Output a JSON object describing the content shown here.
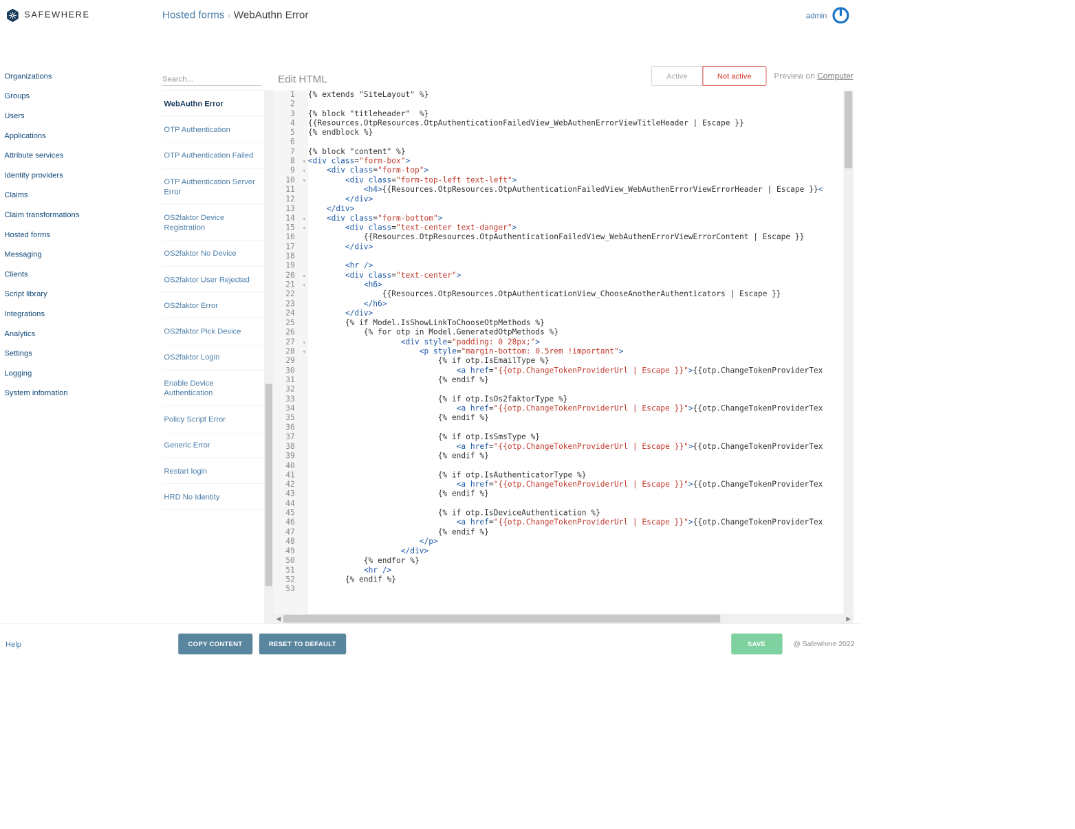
{
  "header": {
    "logo_text": "SAFEWHERE",
    "breadcrumb_parent": "Hosted forms",
    "breadcrumb_sep": "›",
    "breadcrumb_current": "WebAuthn Error",
    "admin": "admin"
  },
  "sidebar": {
    "items": [
      "Organizations",
      "Groups",
      "Users",
      "Applications",
      "Attribute services",
      "Identity providers",
      "Claims",
      "Claim transformations",
      "Hosted forms",
      "Messaging",
      "Clients",
      "Script library",
      "Integrations",
      "Analytics",
      "Settings",
      "Logging",
      "System infomation"
    ]
  },
  "content": {
    "search_placeholder": "Search...",
    "edit_title": "Edit HTML",
    "toggle_active": "Active",
    "toggle_not_active": "Not active",
    "preview_prefix": "Preview on ",
    "preview_link": "Computer"
  },
  "form_list": {
    "selected_index": 0,
    "items": [
      "WebAuthn Error",
      "OTP Authentication",
      "OTP Authentication Failed",
      "OTP Authentication Server Error",
      "OS2faktor Device Registration",
      "OS2faktor No Device",
      "OS2faktor User Rejected",
      "OS2faktor Error",
      "OS2faktor Pick Device",
      "OS2faktor Login",
      "Enable Device Authentication",
      "Policy Script Error",
      "Generic Error",
      "Restart login",
      "HRD No Identity"
    ]
  },
  "editor": {
    "lines": [
      {
        "n": 1,
        "f": "",
        "html": "{% extends \"SiteLayout\" %}"
      },
      {
        "n": 2,
        "f": "",
        "html": ""
      },
      {
        "n": 3,
        "f": "",
        "html": "{% block \"titleheader\"  %}"
      },
      {
        "n": 4,
        "f": "",
        "html": "{{Resources.OtpResources.OtpAuthenticationFailedView_WebAuthenErrorViewTitleHeader | Escape }}"
      },
      {
        "n": 5,
        "f": "",
        "html": "{% endblock %}"
      },
      {
        "n": 6,
        "f": "",
        "html": ""
      },
      {
        "n": 7,
        "f": "",
        "html": "{% block \"content\" %}"
      },
      {
        "n": 8,
        "f": "▾",
        "html": "<span class='t-pun'>&lt;</span><span class='t-tag'>div</span> <span class='t-attr'>class</span>=<span class='t-str'>\"form-box\"</span><span class='t-pun'>&gt;</span>"
      },
      {
        "n": 9,
        "f": "▾",
        "html": "    <span class='t-pun'>&lt;</span><span class='t-tag'>div</span> <span class='t-attr'>class</span>=<span class='t-str'>\"form-top\"</span><span class='t-pun'>&gt;</span>"
      },
      {
        "n": 10,
        "f": "▾",
        "html": "        <span class='t-pun'>&lt;</span><span class='t-tag'>div</span> <span class='t-attr'>class</span>=<span class='t-str'>\"form-top-left text-left\"</span><span class='t-pun'>&gt;</span>"
      },
      {
        "n": 11,
        "f": "",
        "html": "            <span class='t-pun'>&lt;</span><span class='t-tag'>h4</span><span class='t-pun'>&gt;</span>{{Resources.OtpResources.OtpAuthenticationFailedView_WebAuthenErrorViewErrorHeader | Escape }}<span class='t-pun'>&lt;</span>"
      },
      {
        "n": 12,
        "f": "",
        "html": "        <span class='t-pun'>&lt;/</span><span class='t-tag'>div</span><span class='t-pun'>&gt;</span>"
      },
      {
        "n": 13,
        "f": "",
        "html": "    <span class='t-pun'>&lt;/</span><span class='t-tag'>div</span><span class='t-pun'>&gt;</span>"
      },
      {
        "n": 14,
        "f": "▾",
        "html": "    <span class='t-pun'>&lt;</span><span class='t-tag'>div</span> <span class='t-attr'>class</span>=<span class='t-str'>\"form-bottom\"</span><span class='t-pun'>&gt;</span>"
      },
      {
        "n": 15,
        "f": "▾",
        "html": "        <span class='t-pun'>&lt;</span><span class='t-tag'>div</span> <span class='t-attr'>class</span>=<span class='t-str'>\"text-center text-danger\"</span><span class='t-pun'>&gt;</span>"
      },
      {
        "n": 16,
        "f": "",
        "html": "            {{Resources.OtpResources.OtpAuthenticationFailedView_WebAuthenErrorViewErrorContent | Escape }}"
      },
      {
        "n": 17,
        "f": "",
        "html": "        <span class='t-pun'>&lt;/</span><span class='t-tag'>div</span><span class='t-pun'>&gt;</span>"
      },
      {
        "n": 18,
        "f": "",
        "html": ""
      },
      {
        "n": 19,
        "f": "",
        "html": "        <span class='t-pun'>&lt;</span><span class='t-tag'>hr</span> <span class='t-pun'>/&gt;</span>"
      },
      {
        "n": 20,
        "f": "▾",
        "html": "        <span class='t-pun'>&lt;</span><span class='t-tag'>div</span> <span class='t-attr'>class</span>=<span class='t-str'>\"text-center\"</span><span class='t-pun'>&gt;</span>"
      },
      {
        "n": 21,
        "f": "▾",
        "html": "            <span class='t-pun'>&lt;</span><span class='t-tag'>h6</span><span class='t-pun'>&gt;</span>"
      },
      {
        "n": 22,
        "f": "",
        "html": "                {{Resources.OtpResources.OtpAuthenticationView_ChooseAnotherAuthenticators | Escape }}"
      },
      {
        "n": 23,
        "f": "",
        "html": "            <span class='t-pun'>&lt;/</span><span class='t-tag'>h6</span><span class='t-pun'>&gt;</span>"
      },
      {
        "n": 24,
        "f": "",
        "html": "        <span class='t-pun'>&lt;/</span><span class='t-tag'>div</span><span class='t-pun'>&gt;</span>"
      },
      {
        "n": 25,
        "f": "",
        "html": "        {% if Model.IsShowLinkToChooseOtpMethods %}"
      },
      {
        "n": 26,
        "f": "",
        "html": "            {% for otp in Model.GeneratedOtpMethods %}"
      },
      {
        "n": 27,
        "f": "▾",
        "html": "                    <span class='t-pun'>&lt;</span><span class='t-tag'>div</span> <span class='t-attr'>style</span>=<span class='t-str'>\"padding: 0 28px;\"</span><span class='t-pun'>&gt;</span>"
      },
      {
        "n": 28,
        "f": "▾",
        "html": "                        <span class='t-pun'>&lt;</span><span class='t-tag'>p</span> <span class='t-attr'>style</span>=<span class='t-str'>\"margin-bottom: 0.5rem !important\"</span><span class='t-pun'>&gt;</span>"
      },
      {
        "n": 29,
        "f": "",
        "html": "                            {% if otp.IsEmailType %}"
      },
      {
        "n": 30,
        "f": "",
        "html": "                                <span class='t-pun'>&lt;</span><span class='t-tag'>a</span> <span class='t-attr'>href</span>=<span class='t-str'>\"{{otp.ChangeTokenProviderUrl | Escape }}\"</span><span class='t-pun'>&gt;</span>{{otp.ChangeTokenProviderTex"
      },
      {
        "n": 31,
        "f": "",
        "html": "                            {% endif %}"
      },
      {
        "n": 32,
        "f": "",
        "html": ""
      },
      {
        "n": 33,
        "f": "",
        "html": "                            {% if otp.IsOs2faktorType %}"
      },
      {
        "n": 34,
        "f": "",
        "html": "                                <span class='t-pun'>&lt;</span><span class='t-tag'>a</span> <span class='t-attr'>href</span>=<span class='t-str'>\"{{otp.ChangeTokenProviderUrl | Escape }}\"</span><span class='t-pun'>&gt;</span>{{otp.ChangeTokenProviderTex"
      },
      {
        "n": 35,
        "f": "",
        "html": "                            {% endif %}"
      },
      {
        "n": 36,
        "f": "",
        "html": ""
      },
      {
        "n": 37,
        "f": "",
        "html": "                            {% if otp.IsSmsType %}"
      },
      {
        "n": 38,
        "f": "",
        "html": "                                <span class='t-pun'>&lt;</span><span class='t-tag'>a</span> <span class='t-attr'>href</span>=<span class='t-str'>\"{{otp.ChangeTokenProviderUrl | Escape }}\"</span><span class='t-pun'>&gt;</span>{{otp.ChangeTokenProviderTex"
      },
      {
        "n": 39,
        "f": "",
        "html": "                            {% endif %}"
      },
      {
        "n": 40,
        "f": "",
        "html": ""
      },
      {
        "n": 41,
        "f": "",
        "html": "                            {% if otp.IsAuthenticatorType %}"
      },
      {
        "n": 42,
        "f": "",
        "html": "                                <span class='t-pun'>&lt;</span><span class='t-tag'>a</span> <span class='t-attr'>href</span>=<span class='t-str'>\"{{otp.ChangeTokenProviderUrl | Escape }}\"</span><span class='t-pun'>&gt;</span>{{otp.ChangeTokenProviderTex"
      },
      {
        "n": 43,
        "f": "",
        "html": "                            {% endif %}"
      },
      {
        "n": 44,
        "f": "",
        "html": ""
      },
      {
        "n": 45,
        "f": "",
        "html": "                            {% if otp.IsDeviceAuthentication %}"
      },
      {
        "n": 46,
        "f": "",
        "html": "                                <span class='t-pun'>&lt;</span><span class='t-tag'>a</span> <span class='t-attr'>href</span>=<span class='t-str'>\"{{otp.ChangeTokenProviderUrl | Escape }}\"</span><span class='t-pun'>&gt;</span>{{otp.ChangeTokenProviderTex"
      },
      {
        "n": 47,
        "f": "",
        "html": "                            {% endif %}"
      },
      {
        "n": 48,
        "f": "",
        "html": "                        <span class='t-pun'>&lt;/</span><span class='t-tag'>p</span><span class='t-pun'>&gt;</span>"
      },
      {
        "n": 49,
        "f": "",
        "html": "                    <span class='t-pun'>&lt;/</span><span class='t-tag'>div</span><span class='t-pun'>&gt;</span>"
      },
      {
        "n": 50,
        "f": "",
        "html": "            {% endfor %}"
      },
      {
        "n": 51,
        "f": "",
        "html": "            <span class='t-pun'>&lt;</span><span class='t-tag'>hr</span> <span class='t-pun'>/&gt;</span>"
      },
      {
        "n": 52,
        "f": "",
        "html": "        {% endif %}"
      },
      {
        "n": 53,
        "f": "",
        "html": ""
      }
    ]
  },
  "footer": {
    "help": "Help",
    "copy": "COPY CONTENT",
    "reset": "RESET TO DEFAULT",
    "save": "SAVE",
    "copyright": "@ Safewhere 2022"
  }
}
